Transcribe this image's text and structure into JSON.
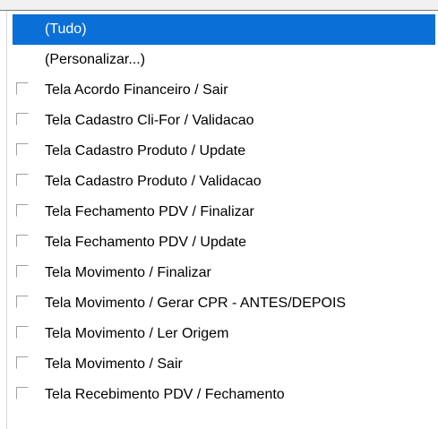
{
  "dropdown": {
    "special_items": [
      {
        "label": "(Tudo)",
        "selected": true
      },
      {
        "label": "(Personalizar...)",
        "selected": false
      }
    ],
    "checkbox_items": [
      {
        "label": "Tela Acordo Financeiro / Sair",
        "checked": false
      },
      {
        "label": "Tela Cadastro Cli-For / Validacao",
        "checked": false
      },
      {
        "label": "Tela Cadastro Produto / Update",
        "checked": false
      },
      {
        "label": "Tela Cadastro Produto / Validacao",
        "checked": false
      },
      {
        "label": "Tela Fechamento PDV / Finalizar",
        "checked": false
      },
      {
        "label": "Tela Fechamento PDV / Update",
        "checked": false
      },
      {
        "label": "Tela Movimento / Finalizar",
        "checked": false
      },
      {
        "label": "Tela Movimento / Gerar CPR - ANTES/DEPOIS",
        "checked": false
      },
      {
        "label": "Tela Movimento / Ler Origem",
        "checked": false
      },
      {
        "label": "Tela Movimento / Sair",
        "checked": false
      },
      {
        "label": "Tela Recebimento PDV / Fechamento",
        "checked": false
      }
    ]
  },
  "colors": {
    "selection": "#0a6fd6",
    "selection_text": "#ffffff",
    "text": "#000000"
  }
}
